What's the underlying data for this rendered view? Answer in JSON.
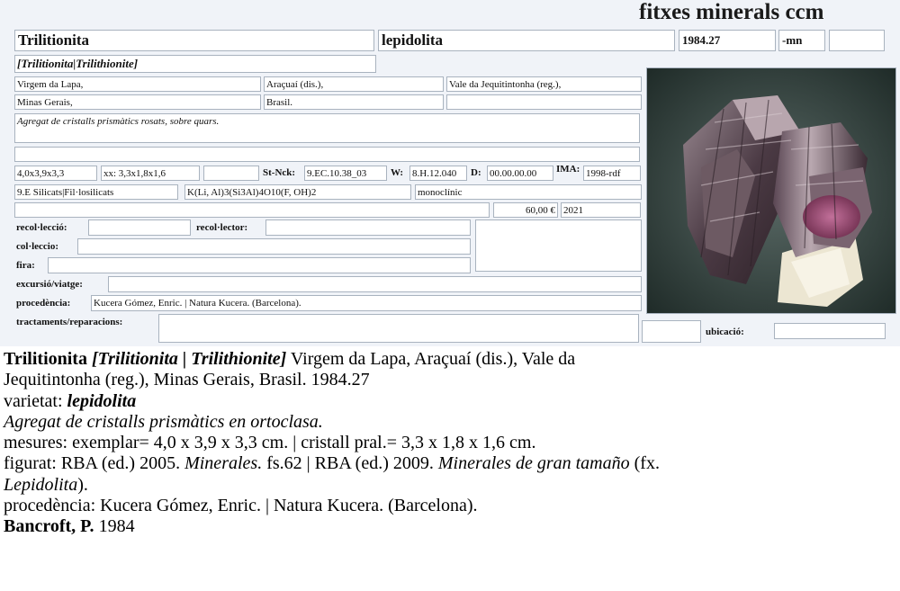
{
  "card": {
    "header_title": "fitxes minerals ccm",
    "species": "Trilitionita",
    "variety": "lepidolita",
    "catalog_number": "1984.27",
    "suffix": "-mn",
    "extra_box": "",
    "synonyms": "[Trilitionita|Trilithionite]",
    "locality_1": "Virgem da Lapa,",
    "district": "Araçuaí (dis.),",
    "region": "Vale da Jequitintonha (reg.),",
    "state": "Minas Gerais,",
    "country": "Brasil.",
    "locality_extra": "",
    "description": "Agregat de cristalls prismàtics rosats, sobre quars.",
    "description_2": "",
    "dimensions": "4,0x3,9x3,3",
    "crystal": "xx: 3,3x1,8x1,6",
    "blank_after_crystal": "",
    "strunz_label": "St-Nck:",
    "strunz_value": "9.EC.10.38_03",
    "w_label": "W:",
    "w_value": "8.H.12.040",
    "d_label": "D:",
    "d_value": "00.00.00.00",
    "ima_label": "IMA:",
    "ima_value": "1998-rdf",
    "class": "9.E Silicats|Fil·losilicats",
    "formula": "K(Li, Al)3(Si3Al)4O10(F, OH)2",
    "crystal_system": "monoclínic",
    "price": "60,00 €",
    "year": "2021",
    "collection_label": "recol·lecció:",
    "collection_value": "",
    "collector_label": "recol·lector:",
    "collector_value": "",
    "coleccio_label": "col·leccio:",
    "coleccio_value": "",
    "fira_label": "fira:",
    "fira_value": "",
    "excursio_label": "excursió/viatge:",
    "excursio_value": "",
    "procedencia_label": "procedència:",
    "procedencia_value": "Kucera Gómez, Enric. | Natura Kucera. (Barcelona).",
    "tractaments_label": "tractaments/reparacions:",
    "tractaments_value": "",
    "ubicacio_label": "ubicació:",
    "ubicacio_value": "",
    "photo_icon": "mineral-specimen-photo"
  },
  "description": {
    "species": "Trilitionita",
    "synonyms": "[Trilitionita | Trilithionite]",
    "locality_line1": " Virgem da Lapa, Araçuaí (dis.), Vale da",
    "locality_line2": "Jequitintonha (reg.), Minas Gerais, Brasil. 1984.27",
    "varietat_label": "varietat: ",
    "varietat_value": "lepidolita",
    "habit": "Agregat de cristalls prismàtics en ortoclasa.",
    "mesures": "mesures: exemplar=  4,0 x 3,9 x 3,3 cm. | cristall pral.=  3,3 x 1,8 x 1,6 cm.",
    "figurat_1": "figurat: RBA (ed.) 2005. ",
    "figurat_2": "Minerales.",
    "figurat_3": " fs.62 | RBA (ed.) 2009. ",
    "figurat_4": "Minerales de gran tamaño",
    "figurat_5": " (fx.",
    "figurat_6": "Lepidolita",
    "figurat_7": ").",
    "procedencia": "procedència: Kucera Gómez, Enric. | Natura Kucera. (Barcelona).",
    "ref_author": "Bancroft, P.",
    "ref_year": " 1984"
  }
}
